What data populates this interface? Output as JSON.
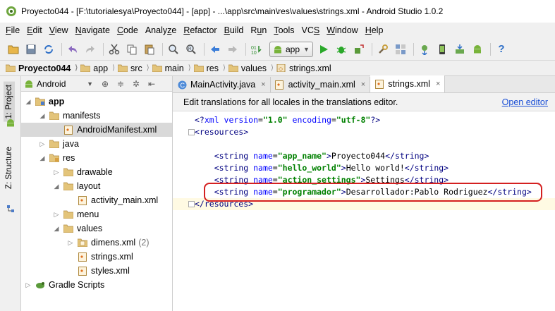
{
  "window": {
    "title": "Proyecto044 - [F:\\tutorialesya\\Proyecto044] - [app] - ...\\app\\src\\main\\res\\values\\strings.xml - Android Studio 1.0.2"
  },
  "menu": {
    "items": [
      {
        "u": "F",
        "rest": "ile"
      },
      {
        "u": "E",
        "rest": "dit"
      },
      {
        "u": "V",
        "rest": "iew"
      },
      {
        "u": "N",
        "rest": "avigate"
      },
      {
        "u": "C",
        "rest": "ode"
      },
      {
        "u": "",
        "rest": "Analy",
        "u2": "z",
        "rest2": "e"
      },
      {
        "u": "R",
        "rest": "efactor"
      },
      {
        "u": "B",
        "rest": "uild"
      },
      {
        "u": "",
        "rest": "R",
        "u2": "u",
        "rest2": "n"
      },
      {
        "u": "T",
        "rest": "ools"
      },
      {
        "u": "",
        "rest": "VC",
        "u2": "S",
        "rest2": ""
      },
      {
        "u": "W",
        "rest": "indow"
      },
      {
        "u": "H",
        "rest": "elp"
      }
    ]
  },
  "toolbar": {
    "run_config": "app"
  },
  "breadcrumb": {
    "items": [
      "Proyecto044",
      "app",
      "src",
      "main",
      "res",
      "values",
      "strings.xml"
    ]
  },
  "left_strip": {
    "project_tab": "1: Project",
    "structure_tab": "Z: Structure"
  },
  "project_panel": {
    "view_mode": "Android",
    "tree": [
      {
        "label": "app",
        "level": 0,
        "toggle": "open",
        "kind": "module",
        "bold": true
      },
      {
        "label": "manifests",
        "level": 1,
        "toggle": "open",
        "kind": "folder"
      },
      {
        "label": "AndroidManifest.xml",
        "level": 2,
        "toggle": "",
        "kind": "xml",
        "selected": true
      },
      {
        "label": "java",
        "level": 1,
        "toggle": "closed",
        "kind": "folder"
      },
      {
        "label": "res",
        "level": 1,
        "toggle": "open",
        "kind": "folder-res"
      },
      {
        "label": "drawable",
        "level": 2,
        "toggle": "closed",
        "kind": "folder"
      },
      {
        "label": "layout",
        "level": 2,
        "toggle": "open",
        "kind": "folder"
      },
      {
        "label": "activity_main.xml",
        "level": 3,
        "toggle": "",
        "kind": "xml"
      },
      {
        "label": "menu",
        "level": 2,
        "toggle": "closed",
        "kind": "folder"
      },
      {
        "label": "values",
        "level": 2,
        "toggle": "open",
        "kind": "folder"
      },
      {
        "label": "dimens.xml",
        "extra": "(2)",
        "level": 3,
        "toggle": "closed",
        "kind": "xml-folder"
      },
      {
        "label": "strings.xml",
        "level": 3,
        "toggle": "",
        "kind": "xml"
      },
      {
        "label": "styles.xml",
        "level": 3,
        "toggle": "",
        "kind": "xml"
      },
      {
        "label": "Gradle Scripts",
        "level": 0,
        "toggle": "closed",
        "kind": "gradle"
      }
    ]
  },
  "editor": {
    "tabs": [
      {
        "label": "MainActivity.java",
        "kind": "java",
        "active": false
      },
      {
        "label": "activity_main.xml",
        "kind": "xml",
        "active": false
      },
      {
        "label": "strings.xml",
        "kind": "xml",
        "active": true
      }
    ],
    "banner": {
      "message": "Edit translations for all locales in the translations editor.",
      "link": "Open editor"
    },
    "lines": [
      {
        "indent": "",
        "parts": [
          [
            "tagc",
            "<?"
          ],
          [
            "attrc",
            "xml version"
          ],
          [
            "",
            "="
          ],
          [
            "valc",
            "\"1.0\""
          ],
          [
            "",
            " "
          ],
          [
            "attrc",
            "encoding"
          ],
          [
            "",
            "="
          ],
          [
            "valc",
            "\"utf-8\""
          ],
          [
            "tagc",
            "?>"
          ]
        ]
      },
      {
        "indent": "",
        "parts": [
          [
            "tagc",
            "<resources>"
          ]
        ]
      },
      {
        "indent": "",
        "parts": []
      },
      {
        "indent": "    ",
        "parts": [
          [
            "tagc",
            "<string "
          ],
          [
            "attrc",
            "name"
          ],
          [
            "",
            "="
          ],
          [
            "valc",
            "\"app_name\""
          ],
          [
            "tagc",
            ">"
          ],
          [
            "",
            "Proyecto044"
          ],
          [
            "tagc",
            "</string>"
          ]
        ]
      },
      {
        "indent": "    ",
        "parts": [
          [
            "tagc",
            "<string "
          ],
          [
            "attrc",
            "name"
          ],
          [
            "",
            "="
          ],
          [
            "valc",
            "\"hello_world\""
          ],
          [
            "tagc",
            ">"
          ],
          [
            "",
            "Hello world!"
          ],
          [
            "tagc",
            "</string>"
          ]
        ]
      },
      {
        "indent": "    ",
        "parts": [
          [
            "tagc",
            "<string "
          ],
          [
            "attrc",
            "name"
          ],
          [
            "",
            "="
          ],
          [
            "valc",
            "\"action_settings\""
          ],
          [
            "tagc",
            ">"
          ],
          [
            "",
            "Settings"
          ],
          [
            "tagc",
            "</string>"
          ]
        ]
      },
      {
        "indent": "    ",
        "parts": [
          [
            "tagc",
            "<string "
          ],
          [
            "attrc",
            "name"
          ],
          [
            "",
            "="
          ],
          [
            "valc",
            "\"programador\""
          ],
          [
            "tagc",
            ">"
          ],
          [
            "",
            "Desarrollador:Pablo Rodriguez"
          ],
          [
            "tagc",
            "</string>"
          ]
        ]
      },
      {
        "indent": "",
        "parts": [
          [
            "tagc",
            "</resources>"
          ]
        ]
      }
    ]
  },
  "colors": {
    "highlight_box": "#d42020",
    "link": "#1a4fd6",
    "current_line": "#fffae3"
  }
}
